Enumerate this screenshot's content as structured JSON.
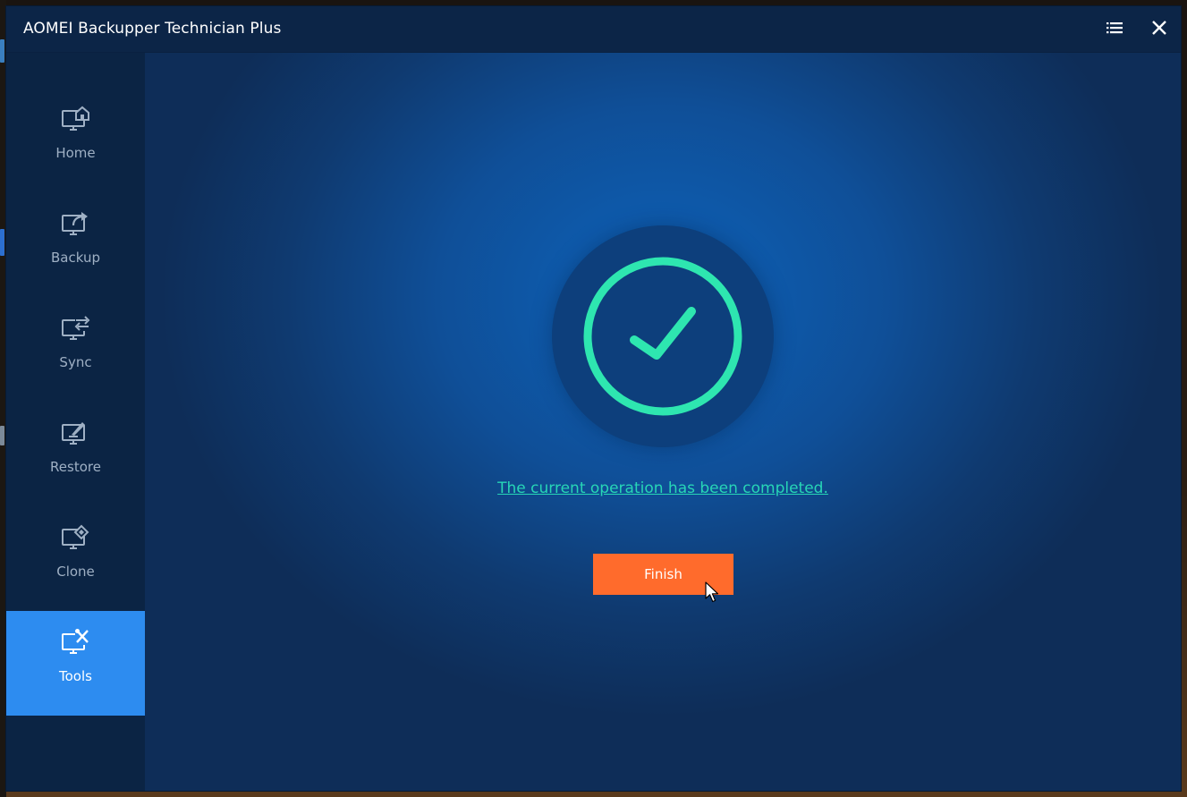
{
  "window": {
    "title": "AOMEI Backupper Technician Plus"
  },
  "titlebar": {
    "menu_icon": "list-menu-icon",
    "close_icon": "close-icon"
  },
  "sidebar": {
    "items": [
      {
        "label": "Home",
        "icon": "monitor-home-icon",
        "active": false
      },
      {
        "label": "Backup",
        "icon": "monitor-backup-icon",
        "active": false
      },
      {
        "label": "Sync",
        "icon": "monitor-sync-icon",
        "active": false
      },
      {
        "label": "Restore",
        "icon": "monitor-restore-icon",
        "active": false
      },
      {
        "label": "Clone",
        "icon": "monitor-clone-icon",
        "active": false
      },
      {
        "label": "Tools",
        "icon": "monitor-tools-icon",
        "active": true
      }
    ]
  },
  "main": {
    "status_icon": "success-check-icon",
    "status_message": "The current operation has been completed.",
    "finish_label": "Finish"
  },
  "colors": {
    "accent_active": "#2d8cf0",
    "success": "#2ee6b0",
    "link": "#27d6b6",
    "finish_button": "#ff6b2c"
  }
}
